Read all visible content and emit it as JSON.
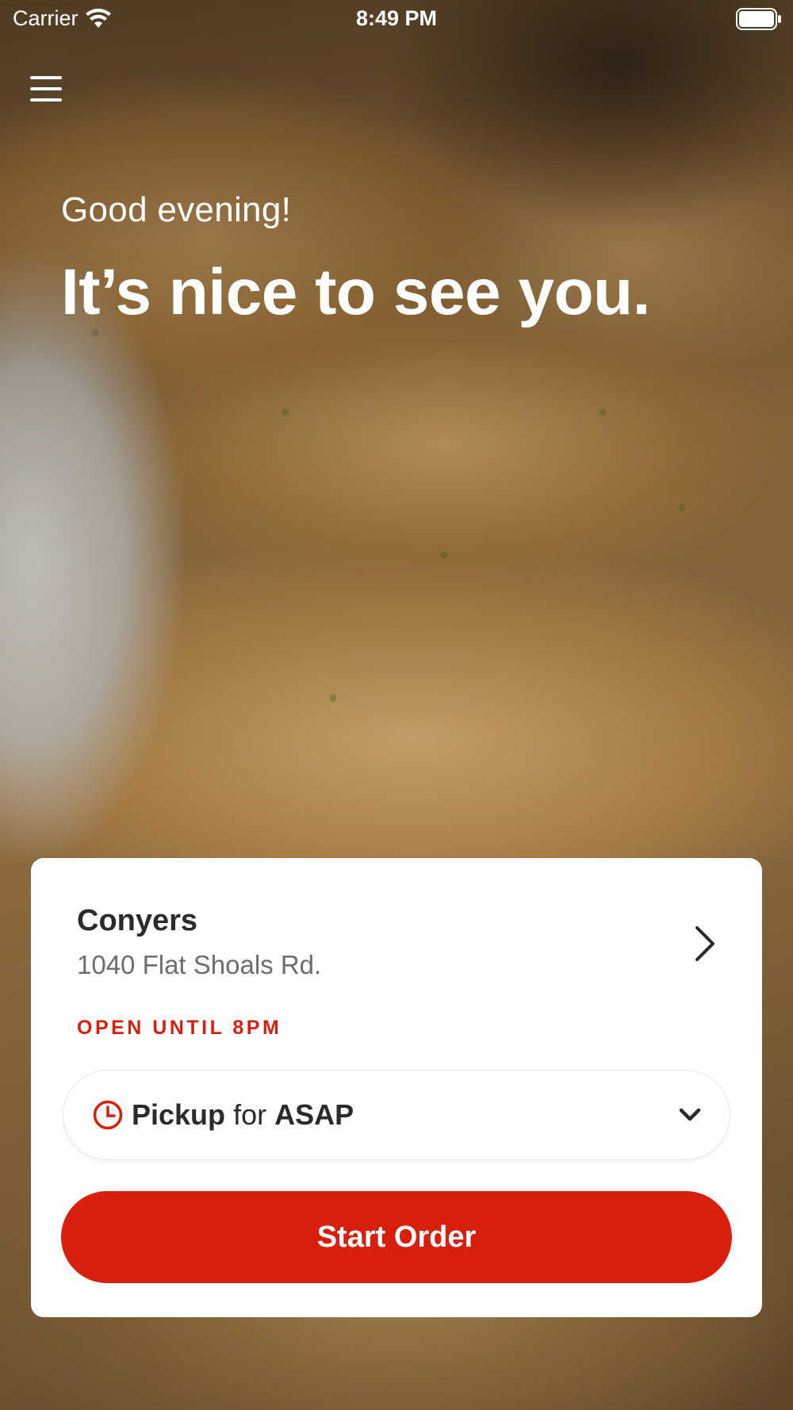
{
  "status_bar": {
    "carrier": "Carrier",
    "time": "8:49 PM",
    "icons": [
      "wifi-icon",
      "battery-icon"
    ]
  },
  "header": {
    "menu_icon": "hamburger-menu-icon",
    "greeting": "Good evening!",
    "headline": "It’s nice to see you."
  },
  "store": {
    "name": "Conyers",
    "address": "1040 Flat Shoals Rd.",
    "hours": "OPEN UNTIL 8PM",
    "chevron_icon": "chevron-right-icon"
  },
  "order_mode": {
    "mode": "Pickup",
    "connector": "for",
    "time": "ASAP",
    "icon": "clock-icon",
    "dropdown_icon": "chevron-down-icon"
  },
  "actions": {
    "start_order": "Start Order"
  },
  "colors": {
    "accent": "#d81f0e",
    "card_bg": "#ffffff",
    "text_dark": "#2b2b2b",
    "text_muted": "#6d6d6d"
  }
}
